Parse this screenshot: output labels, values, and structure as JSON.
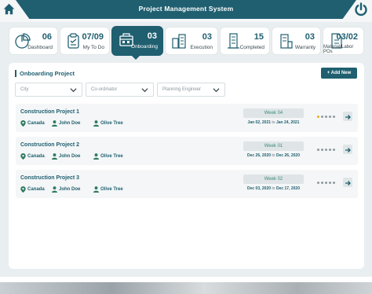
{
  "header": {
    "title": "Project Management System",
    "home_icon": "home-icon",
    "power_icon": "power-icon",
    "brand_color": "#1f5f70"
  },
  "tiles": [
    {
      "count": "06",
      "label": "Dashboard",
      "icon": "pie-chart-icon",
      "active": false
    },
    {
      "count": "07/09",
      "label": "My To Do",
      "icon": "clipboard-icon",
      "active": false
    },
    {
      "count": "03",
      "label": "Onboarding",
      "icon": "onboarding-icon",
      "active": true
    },
    {
      "count": "03",
      "label": "Execution",
      "icon": "buildings-icon",
      "active": false
    },
    {
      "count": "15",
      "label": "Completed",
      "icon": "tower-icon",
      "active": false
    },
    {
      "count": "03",
      "label": "Warranty",
      "icon": "warranty-building-icon",
      "active": false
    },
    {
      "count": "03/02",
      "label": "Material/Labor POs",
      "icon": "document-icon",
      "active": false
    }
  ],
  "main": {
    "title": "Onboarding Project",
    "add_button": "+ Add New",
    "filters": [
      {
        "placeholder": "City"
      },
      {
        "placeholder": "Co-ordinator"
      },
      {
        "placeholder": "Planning Engineer"
      }
    ],
    "projects": [
      {
        "name": "Construction Project 1",
        "city": "Canada",
        "person": "John Doe",
        "company": "Olive Tree",
        "week": "Week 04",
        "start": "Jan 02, 2021",
        "to": "to",
        "end": "Jan 24, 2021",
        "progress_dots_filled": 1,
        "progress_dots_total": 5
      },
      {
        "name": "Construction Project 2",
        "city": "Canada",
        "person": "John Doe",
        "company": "Olive Tree",
        "week": "Week 01",
        "start": "Dec 26, 2020",
        "to": "to",
        "end": "Dec 26, 2020",
        "progress_dots_filled": 0,
        "progress_dots_total": 5
      },
      {
        "name": "Construction Project 3",
        "city": "Canada",
        "person": "John Doe",
        "company": "Olive Tree",
        "week": "Week 02",
        "start": "Dec 03, 2020",
        "to": "to",
        "end": "Dec 17, 2020",
        "progress_dots_filled": 0,
        "progress_dots_total": 5
      }
    ]
  }
}
